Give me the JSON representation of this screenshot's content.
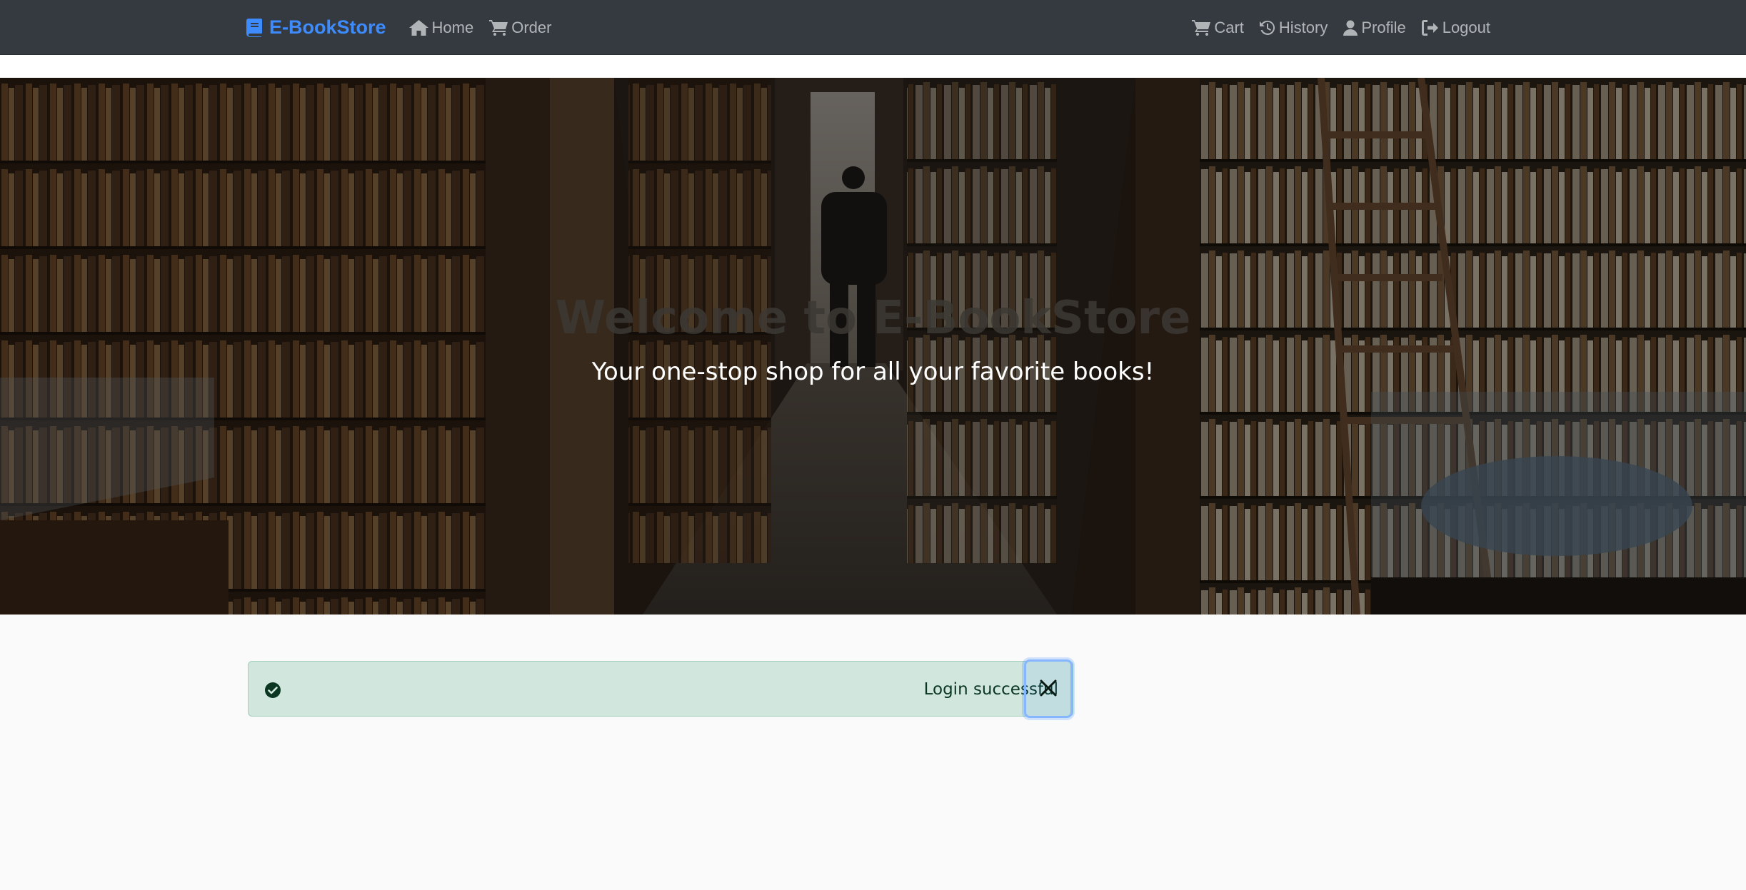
{
  "nav": {
    "brand": "E-BookStore",
    "left_links": [
      {
        "label": "Home",
        "icon": "home-icon"
      },
      {
        "label": "Order",
        "icon": "cart-icon"
      }
    ],
    "right_links": [
      {
        "label": "Cart",
        "icon": "cart-icon"
      },
      {
        "label": "History",
        "icon": "history-icon"
      },
      {
        "label": "Profile",
        "icon": "user-icon"
      },
      {
        "label": "Logout",
        "icon": "logout-icon"
      }
    ]
  },
  "hero": {
    "title": "Welcome to E-BookStore",
    "subtitle": "Your one-stop shop for all your favorite books!"
  },
  "alert": {
    "message": "Login successful",
    "icon": "check-circle-icon",
    "close_icon": "close-icon"
  },
  "colors": {
    "navbar": "#343a40",
    "brand": "#3d8bfd",
    "alert_bg": "#d1e7dd",
    "alert_text": "#0a3622"
  }
}
